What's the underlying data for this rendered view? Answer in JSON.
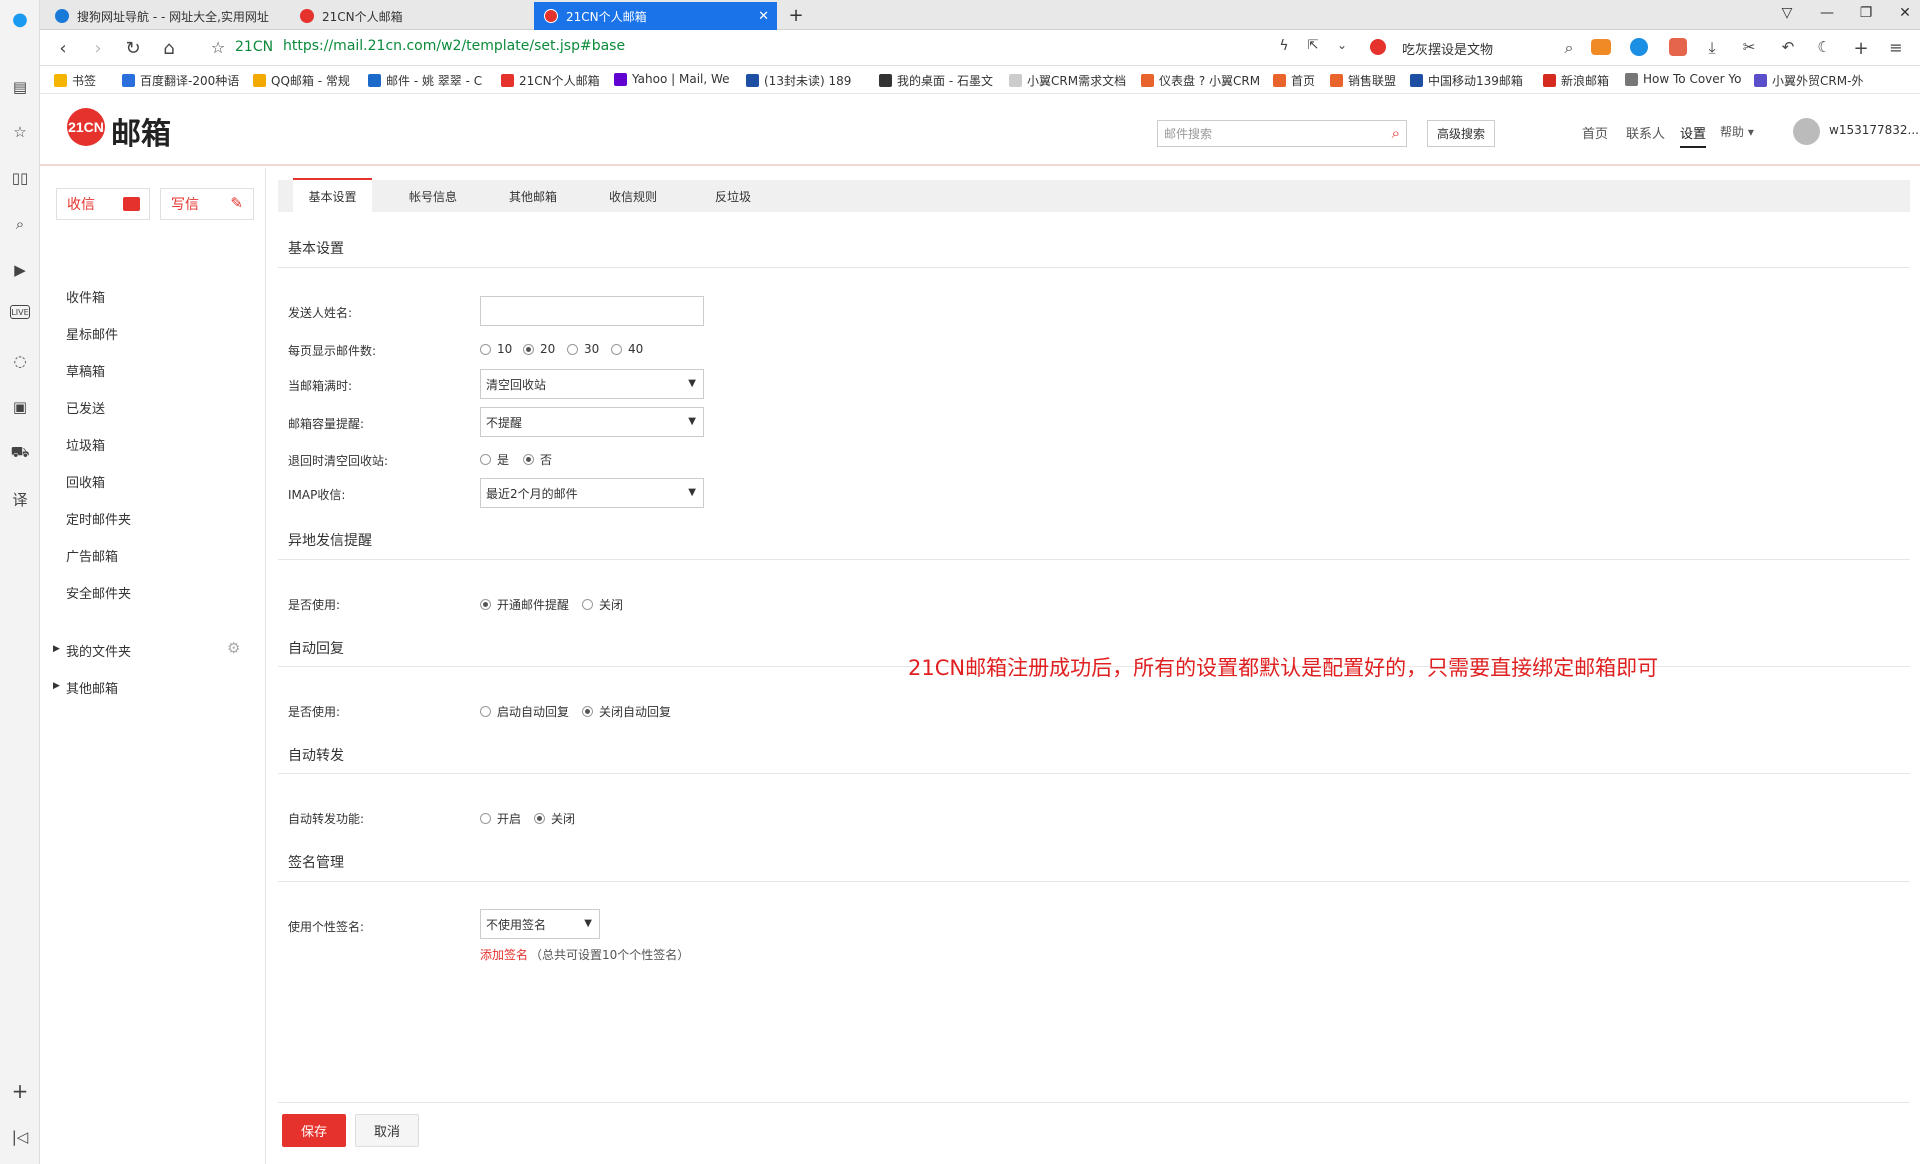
{
  "browser": {
    "tabs": [
      {
        "label": "搜狗网址导航 - - 网址大全,实用网址"
      },
      {
        "label": "21CN个人邮箱"
      },
      {
        "label": "21CN个人邮箱"
      }
    ],
    "url_domain_label": "21CN",
    "url": "https://mail.21cn.com/w2/template/set.jsp#base",
    "search_hint": "吃灰摆设是文物",
    "bookmarks": [
      {
        "label": "书签",
        "color": "#f5b400"
      },
      {
        "label": "百度翻译-200种语",
        "color": "#2a6fdb"
      },
      {
        "label": "QQ邮箱 - 常规",
        "color": "#f2a900"
      },
      {
        "label": "邮件 - 姚 翠翠 - C",
        "color": "#1b6ac9"
      },
      {
        "label": "21CN个人邮箱",
        "color": "#e5322c"
      },
      {
        "label": "Yahoo | Mail, We",
        "color": "#6001d2"
      },
      {
        "label": "(13封未读) 189",
        "color": "#1d4fa3"
      },
      {
        "label": "我的桌面 - 石墨文",
        "color": "#333333"
      },
      {
        "label": "小翼CRM需求文档",
        "color": "#cccccc"
      },
      {
        "label": "仪表盘 ? 小翼CRM",
        "color": "#e8642c"
      },
      {
        "label": "首页",
        "color": "#e8642c"
      },
      {
        "label": "销售联盟",
        "color": "#e8642c"
      },
      {
        "label": "中国移动139邮箱",
        "color": "#1d4fa3"
      },
      {
        "label": "新浪邮箱",
        "color": "#d52b1e"
      },
      {
        "label": "How To Cover Yo",
        "color": "#777777"
      },
      {
        "label": "小翼外贸CRM-外",
        "color": "#5b4fc9"
      }
    ]
  },
  "header": {
    "logo_badge": "21CN",
    "logo_text": "邮箱",
    "search_placeholder": "邮件搜索",
    "advanced_search": "高级搜索",
    "nav": [
      "首页",
      "联系人",
      "设置",
      "帮助 ▾"
    ],
    "username": "w153177832..."
  },
  "sidebar": {
    "receive": "收信",
    "compose": "写信",
    "folders": [
      "收件箱",
      "星标邮件",
      "草稿箱",
      "已发送",
      "垃圾箱",
      "回收箱",
      "定时邮件夹",
      "广告邮箱",
      "安全邮件夹"
    ],
    "my_folders": "我的文件夹",
    "other_mail": "其他邮箱"
  },
  "settings": {
    "tabs": [
      "基本设置",
      "帐号信息",
      "其他邮箱",
      "收信规则",
      "反垃圾"
    ],
    "sections": {
      "basic": "基本设置",
      "remote": "异地发信提醒",
      "autoreply": "自动回复",
      "forward": "自动转发",
      "signature": "签名管理"
    },
    "labels": {
      "sender_name": "发送人姓名:",
      "per_page": "每页显示邮件数:",
      "when_full": "当邮箱满时:",
      "capacity": "邮箱容量提醒:",
      "empty_trash": "退回时清空回收站:",
      "imap": "IMAP收信:",
      "remote_use": "是否使用:",
      "autoreply_use": "是否使用:",
      "forward_func": "自动转发功能:",
      "use_sig": "使用个性签名:"
    },
    "sender_name_value": "",
    "per_page_options": [
      "10",
      "20",
      "30",
      "40"
    ],
    "per_page_selected": "20",
    "when_full_value": "清空回收站",
    "capacity_value": "不提醒",
    "empty_trash_options": [
      "是",
      "否"
    ],
    "empty_trash_selected": "否",
    "imap_value": "最近2个月的邮件",
    "remote_options": [
      "开通邮件提醒",
      "关闭"
    ],
    "remote_selected": "开通邮件提醒",
    "autoreply_options": [
      "启动自动回复",
      "关闭自动回复"
    ],
    "autoreply_selected": "关闭自动回复",
    "forward_options": [
      "开启",
      "关闭"
    ],
    "forward_selected": "关闭",
    "signature_value": "不使用签名",
    "add_signature": "添加签名",
    "signature_hint": "（总共可设置10个个性签名）"
  },
  "annotation": "21CN邮箱注册成功后，所有的设置都默认是配置好的，只需要直接绑定邮箱即可",
  "actions": {
    "save": "保存",
    "cancel": "取消"
  }
}
